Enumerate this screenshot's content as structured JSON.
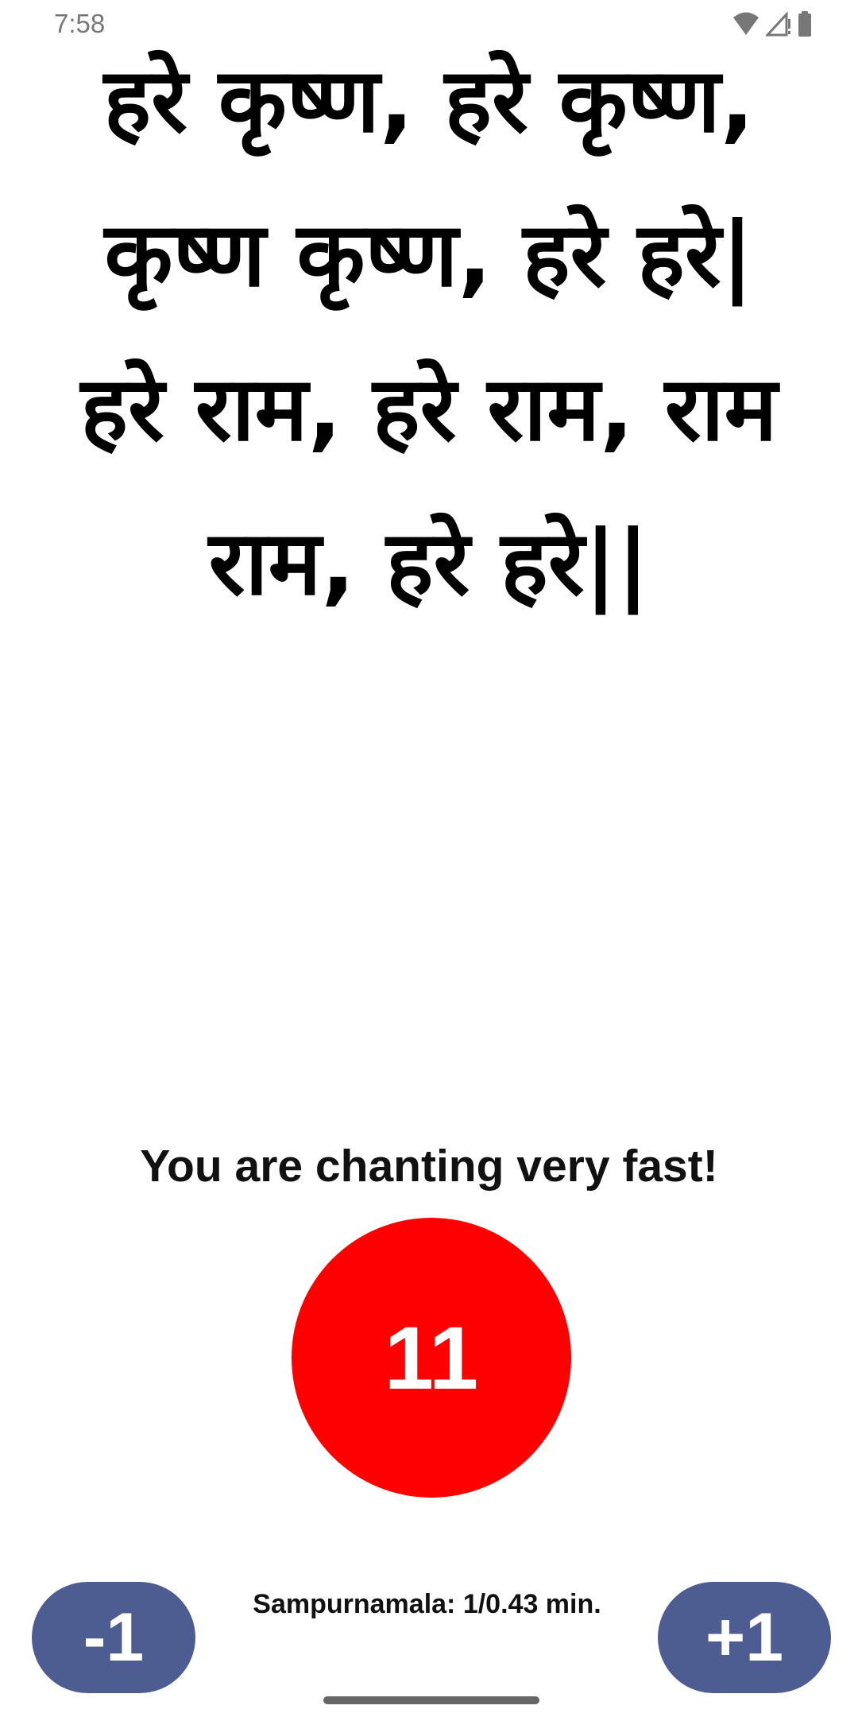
{
  "status_bar": {
    "time": "7:58",
    "icons": [
      "wifi-icon",
      "cell-signal-icon",
      "battery-icon"
    ]
  },
  "mantra": {
    "lines": [
      "हरे कृष्ण, हरे कृष्ण,",
      "कृष्ण कृष्ण, हरे हरे|",
      "हरे राम, हरे राम, राम",
      "राम, हरे हरे||"
    ]
  },
  "feedback": {
    "message": "You are chanting very fast!"
  },
  "counter": {
    "value": "11",
    "color": "#ff0000"
  },
  "controls": {
    "decrement_label": "-1",
    "increment_label": "+1",
    "button_color": "#4d5d91"
  },
  "stats": {
    "text": "Sampurnamala: 1/0.43 min."
  }
}
